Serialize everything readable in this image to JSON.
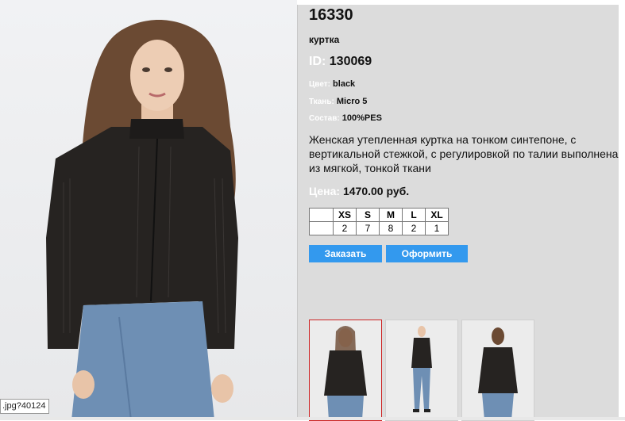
{
  "product": {
    "number": "16330",
    "category": "куртка",
    "id_label": "ID:",
    "id_value": "130069",
    "attributes": [
      {
        "label": "Цвет:",
        "value": "black"
      },
      {
        "label": "Ткань:",
        "value": "Micro 5"
      },
      {
        "label": "Состав:",
        "value": "100%PES"
      }
    ],
    "description": "Женская утепленная куртка на тонком синтепоне, с вертикальной стежкой, с регулировкой по талии выполнена из мягкой, тонкой ткани",
    "price_label": "Цена:",
    "price_value": "1470.00 руб."
  },
  "sizes": {
    "headers": [
      "XS",
      "S",
      "M",
      "L",
      "XL"
    ],
    "counts": [
      "2",
      "7",
      "8",
      "2",
      "1"
    ]
  },
  "buttons": {
    "order": "Заказать",
    "checkout": "Оформить"
  },
  "tooltip": ".jpg?40124",
  "colors": {
    "panel_bg": "#dcdcdc",
    "button_bg": "#3399ee",
    "label_white": "#ffffff",
    "active_thumb_border": "#cc2222"
  },
  "thumbnails": [
    {
      "name": "front-view",
      "active": true
    },
    {
      "name": "full-body-view",
      "active": false
    },
    {
      "name": "back-view",
      "active": false
    }
  ]
}
